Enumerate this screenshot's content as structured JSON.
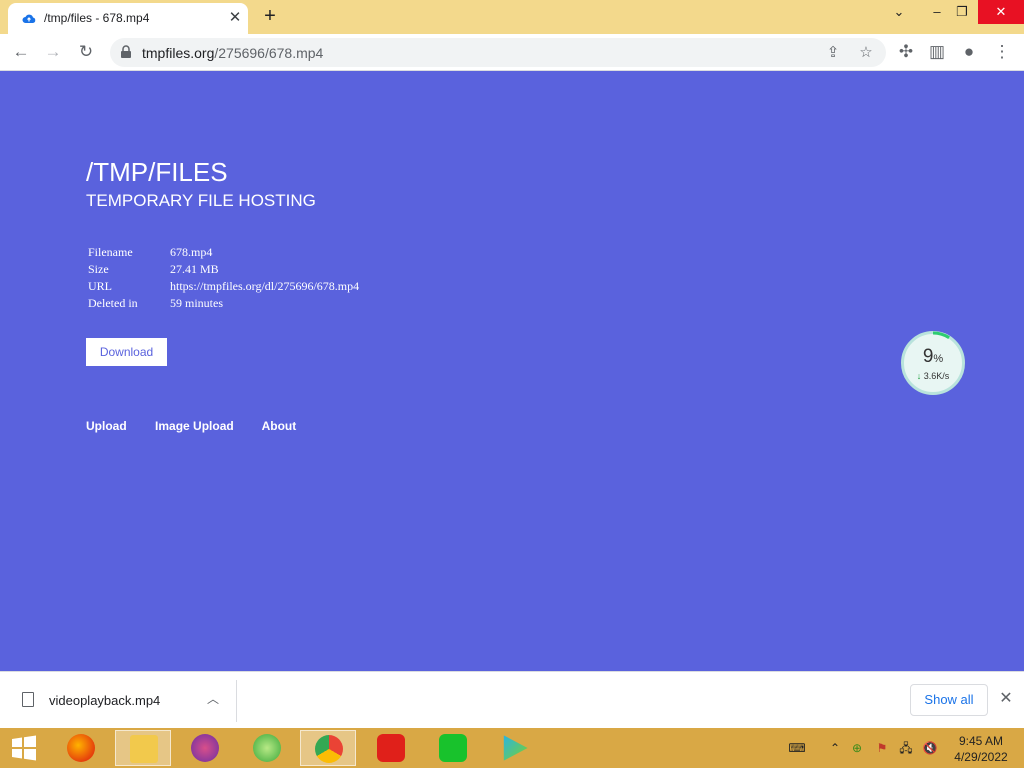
{
  "browser": {
    "tab_title": "/tmp/files - 678.mp4",
    "url_host": "tmpfiles.org",
    "url_path": "/275696/678.mp4"
  },
  "site": {
    "title": "/TMP/FILES",
    "subtitle": "TEMPORARY FILE HOSTING",
    "info": [
      {
        "label": "Filename",
        "value": "678.mp4"
      },
      {
        "label": "Size",
        "value": "27.41 MB"
      },
      {
        "label": "URL",
        "value": "https://tmpfiles.org/dl/275696/678.mp4"
      },
      {
        "label": "Deleted in",
        "value": "59 minutes"
      }
    ],
    "download_label": "Download",
    "footer_links": [
      "Upload",
      "Image Upload",
      "About"
    ]
  },
  "speed_widget": {
    "percent": "9",
    "percent_unit": "%",
    "rate": "3.6K/s",
    "progress_fraction": 0.09
  },
  "download_shelf": {
    "file_name": "videoplayback.mp4",
    "show_all_label": "Show all"
  },
  "taskbar": {
    "time": "9:45 AM",
    "date": "4/29/2022"
  },
  "colors": {
    "page_bg": "#5a62dd",
    "tabstrip_bg": "#f3d98c",
    "taskbar_bg": "#d9a845",
    "accent": "#1a73e8"
  }
}
